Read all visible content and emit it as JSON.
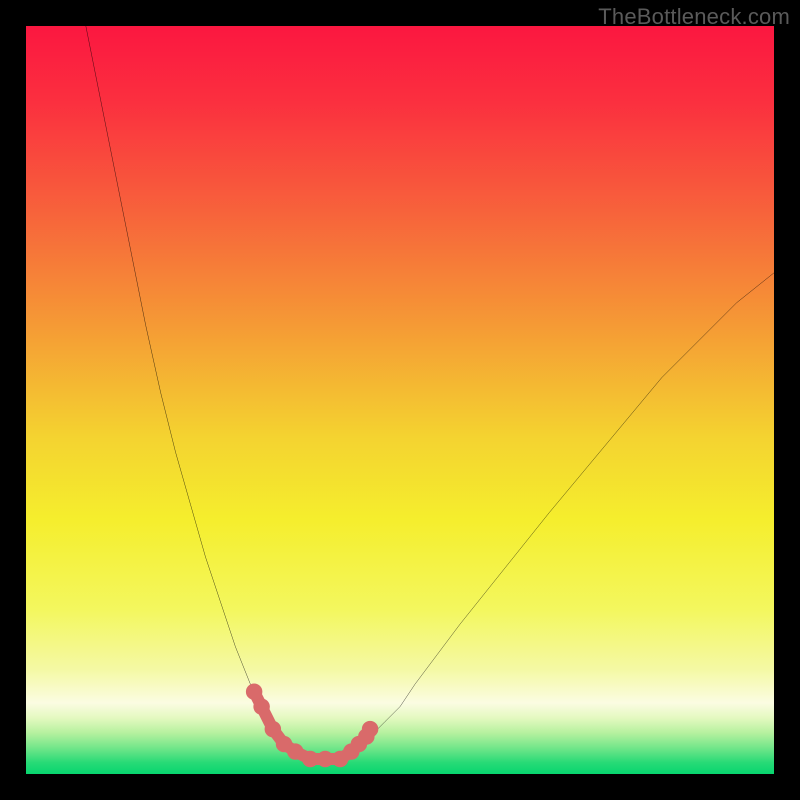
{
  "watermark": {
    "text": "TheBottleneck.com"
  },
  "colors": {
    "black": "#000000",
    "curve": "#000000",
    "marker": "#d96a6a",
    "marker_stroke": "#d96a6a"
  },
  "gradient": {
    "stops": [
      {
        "offset": 0.0,
        "color": "#fb1740"
      },
      {
        "offset": 0.1,
        "color": "#fb2f3f"
      },
      {
        "offset": 0.25,
        "color": "#f7633b"
      },
      {
        "offset": 0.4,
        "color": "#f59a35"
      },
      {
        "offset": 0.55,
        "color": "#f4d330"
      },
      {
        "offset": 0.66,
        "color": "#f5ee2d"
      },
      {
        "offset": 0.78,
        "color": "#f3f75e"
      },
      {
        "offset": 0.86,
        "color": "#f4f9a4"
      },
      {
        "offset": 0.905,
        "color": "#fbfce2"
      },
      {
        "offset": 0.925,
        "color": "#e4f9c0"
      },
      {
        "offset": 0.945,
        "color": "#b6f19f"
      },
      {
        "offset": 0.965,
        "color": "#73e68a"
      },
      {
        "offset": 0.985,
        "color": "#27da76"
      },
      {
        "offset": 1.0,
        "color": "#07d56f"
      }
    ]
  },
  "chart_data": {
    "type": "line",
    "title": "",
    "xlabel": "",
    "ylabel": "",
    "xlim": [
      0,
      100
    ],
    "ylim": [
      0,
      100
    ],
    "grid": false,
    "legend": false,
    "series": [
      {
        "name": "bottleneck-left-curve",
        "x": [
          8,
          10,
          12,
          14,
          16,
          18,
          20,
          22,
          24,
          26,
          28,
          30,
          31,
          32,
          34,
          36
        ],
        "y": [
          100,
          90,
          80,
          70,
          60,
          51,
          43,
          36,
          29,
          23,
          17,
          12,
          10,
          8,
          5,
          3
        ]
      },
      {
        "name": "bottleneck-right-curve",
        "x": [
          44,
          46,
          48,
          50,
          52,
          55,
          58,
          62,
          66,
          70,
          75,
          80,
          85,
          90,
          95,
          100
        ],
        "y": [
          3,
          5,
          7,
          9,
          12,
          16,
          20,
          25,
          30,
          35,
          41,
          47,
          53,
          58,
          63,
          67
        ]
      },
      {
        "name": "bottleneck-floor",
        "x": [
          36,
          38,
          40,
          42,
          44
        ],
        "y": [
          3,
          2,
          2,
          2,
          3
        ]
      }
    ],
    "markers": {
      "name": "highlighted-segment",
      "points": [
        {
          "x": 30.5,
          "y": 11
        },
        {
          "x": 31.5,
          "y": 9
        },
        {
          "x": 33.0,
          "y": 6
        },
        {
          "x": 34.5,
          "y": 4
        },
        {
          "x": 36.0,
          "y": 3
        },
        {
          "x": 38.0,
          "y": 2
        },
        {
          "x": 40.0,
          "y": 2
        },
        {
          "x": 42.0,
          "y": 2
        },
        {
          "x": 43.5,
          "y": 3
        },
        {
          "x": 44.5,
          "y": 4
        },
        {
          "x": 45.5,
          "y": 5
        },
        {
          "x": 46.0,
          "y": 6
        }
      ]
    }
  }
}
